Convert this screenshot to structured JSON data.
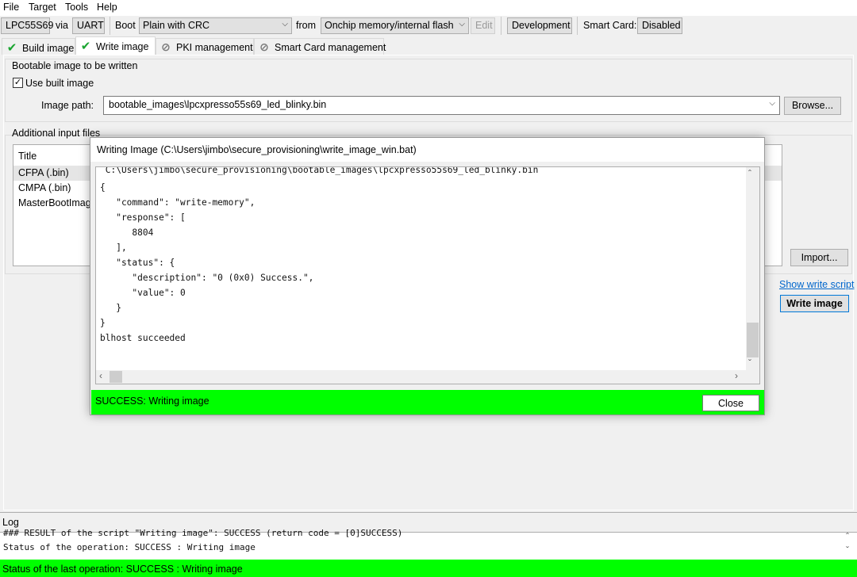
{
  "menu": {
    "file": "File",
    "target": "Target",
    "tools": "Tools",
    "help": "Help"
  },
  "toolbar": {
    "device": "LPC55S69",
    "via": "via",
    "interface": "UART",
    "boot_label": "Boot",
    "boot_type": "Plain with CRC",
    "from_label": "from",
    "memory": "Onchip memory/internal flash",
    "edit": "Edit",
    "lifecycle": "Development",
    "smartcard_label": "Smart Card:",
    "smartcard_value": "Disabled"
  },
  "tabs": [
    "Build image",
    "Write image",
    "PKI management",
    "Smart Card management"
  ],
  "bootable": {
    "group_label": "Bootable image to be written",
    "use_built_label": "Use built image",
    "image_path_label": "Image path:",
    "image_path": "bootable_images\\lpcxpresso55s69_led_blinky.bin",
    "browse": "Browse..."
  },
  "additional": {
    "group_label": "Additional input files",
    "column_title": "Title",
    "rows": [
      "CFPA (.bin)",
      "CMPA (.bin)",
      "MasterBootImag"
    ],
    "import": "Import..."
  },
  "actions": {
    "show_script": "Show write script",
    "write": "Write image"
  },
  "dialog": {
    "title": "Writing Image (C:\\Users\\jimbo\\secure_provisioning\\write_image_win.bat)",
    "console_lines": [
      " C:\\Users\\jimbo\\secure_provisioning\\bootable_images\\lpcxpresso55s69_led_blinky.bin",
      "{",
      "   \"command\": \"write-memory\",",
      "   \"response\": [",
      "      8804",
      "   ],",
      "   \"status\": {",
      "      \"description\": \"0 (0x0) Success.\",",
      "      \"value\": 0",
      "   }",
      "}",
      "blhost succeeded"
    ],
    "status": "SUCCESS: Writing image",
    "close": "Close"
  },
  "log": {
    "label": "Log",
    "lines": [
      "### RESULT of the script \"Writing image\": SUCCESS (return code = [0]SUCCESS)",
      "Status of the operation: SUCCESS : Writing image"
    ]
  },
  "statusbar": "Status of the last operation: SUCCESS : Writing image",
  "colors": {
    "success": "#00ff00",
    "link": "#0066cc",
    "check": "#1aa530"
  }
}
